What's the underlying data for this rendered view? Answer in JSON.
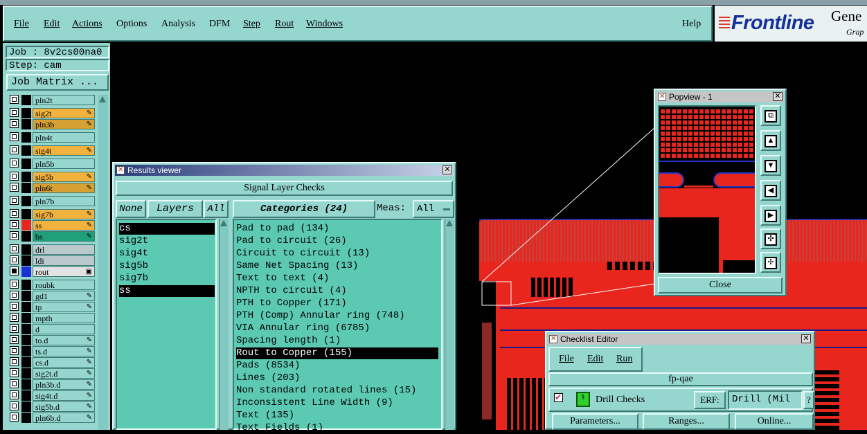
{
  "menubar": {
    "items": [
      "File",
      "Edit",
      "Actions",
      "Options",
      "Analysis",
      "DFM",
      "Step",
      "Rout",
      "Windows"
    ],
    "help": "Help"
  },
  "logo": {
    "brand": "Frontline",
    "product_partial": "Gene",
    "sub_partial": "Grap"
  },
  "job": {
    "job_line": "Job : 8v2cs00na0",
    "step_line": "Step: cam",
    "matrix_button": "Job Matrix ..."
  },
  "layers": [
    {
      "name": "pln2t",
      "color": "#95d6cf",
      "checked": false,
      "swatch": "#000",
      "pen": false
    },
    {
      "name": "sig2t",
      "color": "#f2b23e",
      "checked": false,
      "swatch": "#000",
      "pen": true
    },
    {
      "name": "pln3b",
      "color": "#d6a032",
      "checked": false,
      "swatch": "#000",
      "pen": true
    },
    {
      "name": "pln4t",
      "color": "#95d6cf",
      "checked": false,
      "swatch": "#000",
      "pen": false
    },
    {
      "name": "sig4t",
      "color": "#f2b23e",
      "checked": false,
      "swatch": "#000",
      "pen": true
    },
    {
      "name": "pln5b",
      "color": "#95d6cf",
      "checked": false,
      "swatch": "#000",
      "pen": false
    },
    {
      "name": "sig5b",
      "color": "#f2b23e",
      "checked": false,
      "swatch": "#000",
      "pen": true
    },
    {
      "name": "pln6t",
      "color": "#d6a032",
      "checked": false,
      "swatch": "#000",
      "pen": true
    },
    {
      "name": "pln7b",
      "color": "#95d6cf",
      "checked": false,
      "swatch": "#000",
      "pen": false
    },
    {
      "name": "sig7b",
      "color": "#f2b23e",
      "checked": false,
      "swatch": "#000",
      "pen": true
    },
    {
      "name": "ss",
      "color": "#f2b23e",
      "checked": false,
      "swatch": "#e8261e",
      "pen": true
    },
    {
      "name": "bs",
      "color": "#1fa07a",
      "checked": false,
      "swatch": "#000",
      "pen": true
    },
    {
      "name": "drl",
      "color": "#b9c9cc",
      "checked": false,
      "swatch": "#000",
      "pen": false
    },
    {
      "name": "ldi",
      "color": "#b9c9cc",
      "checked": false,
      "swatch": "#000",
      "pen": false
    },
    {
      "name": "rout",
      "color": "#e2e2e2",
      "checked": true,
      "swatch": "#1a2fd6",
      "pen": false
    },
    {
      "name": "roubk",
      "color": "#95d6cf",
      "checked": false,
      "swatch": "#000",
      "pen": false
    },
    {
      "name": "gd1",
      "color": "#95d6cf",
      "checked": false,
      "swatch": "#000",
      "pen": true
    },
    {
      "name": "tp",
      "color": "#95d6cf",
      "checked": false,
      "swatch": "#000",
      "pen": true
    },
    {
      "name": "mpth",
      "color": "#95d6cf",
      "checked": false,
      "swatch": "#000",
      "pen": false
    },
    {
      "name": "d",
      "color": "#95d6cf",
      "checked": false,
      "swatch": "#000",
      "pen": false
    },
    {
      "name": "to.d",
      "color": "#95d6cf",
      "checked": false,
      "swatch": "#000",
      "pen": true
    },
    {
      "name": "ts.d",
      "color": "#95d6cf",
      "checked": false,
      "swatch": "#000",
      "pen": true
    },
    {
      "name": "cs.d",
      "color": "#95d6cf",
      "checked": false,
      "swatch": "#000",
      "pen": true
    },
    {
      "name": "sig2t.d",
      "color": "#95d6cf",
      "checked": false,
      "swatch": "#000",
      "pen": true
    },
    {
      "name": "pln3b.d",
      "color": "#95d6cf",
      "checked": false,
      "swatch": "#000",
      "pen": true
    },
    {
      "name": "sig4t.d",
      "color": "#95d6cf",
      "checked": false,
      "swatch": "#000",
      "pen": true
    },
    {
      "name": "sig5b.d",
      "color": "#95d6cf",
      "checked": false,
      "swatch": "#000",
      "pen": true
    },
    {
      "name": "pln6b.d",
      "color": "#95d6cf",
      "checked": false,
      "swatch": "#000",
      "pen": true
    }
  ],
  "results": {
    "title": "Results viewer",
    "header": "Signal Layer Checks",
    "none_btn": "None",
    "layers_btn": "Layers",
    "all_btn": "All",
    "categories_btn": "Categories (24)",
    "meas_label": "Meas:",
    "meas_value": "All",
    "layer_list": [
      {
        "text": "cs",
        "selected": true
      },
      {
        "text": "sig2t",
        "selected": false
      },
      {
        "text": "sig4t",
        "selected": false
      },
      {
        "text": "sig5b",
        "selected": false
      },
      {
        "text": "sig7b",
        "selected": false
      },
      {
        "text": "ss",
        "selected": true
      }
    ],
    "categories": [
      {
        "text": "Pad to pad (134)",
        "selected": false
      },
      {
        "text": "Pad to circuit (26)",
        "selected": false
      },
      {
        "text": "Circuit to circuit (13)",
        "selected": false
      },
      {
        "text": "Same Net Spacing (13)",
        "selected": false
      },
      {
        "text": "Text to text (4)",
        "selected": false
      },
      {
        "text": "NPTH to circuit (4)",
        "selected": false
      },
      {
        "text": "PTH to Copper (171)",
        "selected": false
      },
      {
        "text": "PTH (Comp) Annular ring (748)",
        "selected": false
      },
      {
        "text": "VIA Annular ring (6785)",
        "selected": false
      },
      {
        "text": "Spacing length (1)",
        "selected": false
      },
      {
        "text": "Rout to Copper (155)",
        "selected": true
      },
      {
        "text": "Pads (8534)",
        "selected": false
      },
      {
        "text": "Lines (203)",
        "selected": false
      },
      {
        "text": "Non standard rotated lines (15)",
        "selected": false
      },
      {
        "text": "Inconsistent Line Width (9)",
        "selected": false
      },
      {
        "text": "Text (135)",
        "selected": false
      },
      {
        "text": "Text Fields (1)",
        "selected": false
      }
    ]
  },
  "popview": {
    "title": "Popview - 1",
    "close_btn": "Close",
    "tools": [
      "zoom-fit-icon",
      "pan-up-icon",
      "pan-down-icon",
      "pan-left-icon",
      "pan-right-icon",
      "zoom-in-icon",
      "zoom-out-icon"
    ]
  },
  "checklist": {
    "title": "Checklist Editor",
    "menu": [
      "File",
      "Edit",
      "Run"
    ],
    "name": "fp-qae",
    "item_label": "Drill Checks",
    "erf_label": "ERF:",
    "erf_value": "Drill (Mil",
    "help_btn": "?",
    "buttons": [
      "Parameters...",
      "Ranges...",
      "Online..."
    ]
  }
}
